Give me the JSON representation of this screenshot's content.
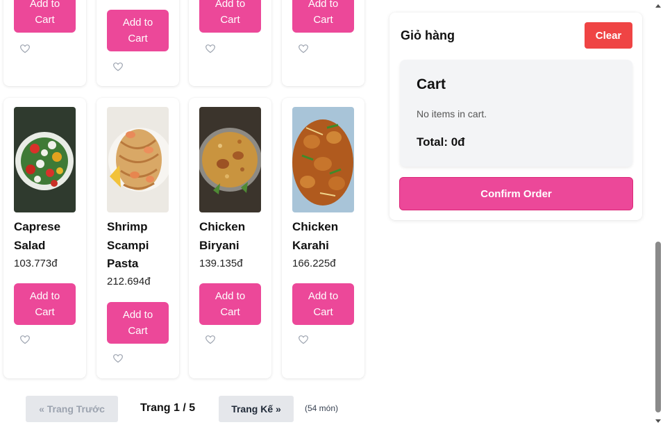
{
  "products_top": [
    {
      "add_label": "Add to Cart"
    },
    {
      "add_label": "Add to Cart"
    },
    {
      "add_label": "Add to Cart"
    },
    {
      "add_label": "Add to Cart"
    }
  ],
  "products": [
    {
      "name": "Caprese Salad",
      "price": "103.773đ",
      "add_label": "Add to Cart",
      "image": "caprese-salad-photo"
    },
    {
      "name": "Shrimp Scampi Pasta",
      "price": "212.694đ",
      "add_label": "Add to Cart",
      "image": "shrimp-scampi-pasta-photo"
    },
    {
      "name": "Chicken Biryani",
      "price": "139.135đ",
      "add_label": "Add to Cart",
      "image": "chicken-biryani-photo"
    },
    {
      "name": "Chicken Karahi",
      "price": "166.225đ",
      "add_label": "Add to Cart",
      "image": "chicken-karahi-photo"
    }
  ],
  "pagination": {
    "prev_label": "« Trang Trước",
    "page_label": "Trang 1 / 5",
    "next_label": "Trang Kế »",
    "count_label": "(54 món)"
  },
  "cart": {
    "title": "Giỏ hàng",
    "clear_label": "Clear",
    "box_title": "Cart",
    "empty_text": "No items in cart.",
    "total_text": "Total: 0đ",
    "confirm_label": "Confirm Order"
  },
  "colors": {
    "accent": "#ec4899",
    "danger": "#ef4444",
    "panel_bg": "#f3f4f6"
  },
  "icons": [
    "heart-icon",
    "scroll-up-icon",
    "scroll-down-icon"
  ]
}
